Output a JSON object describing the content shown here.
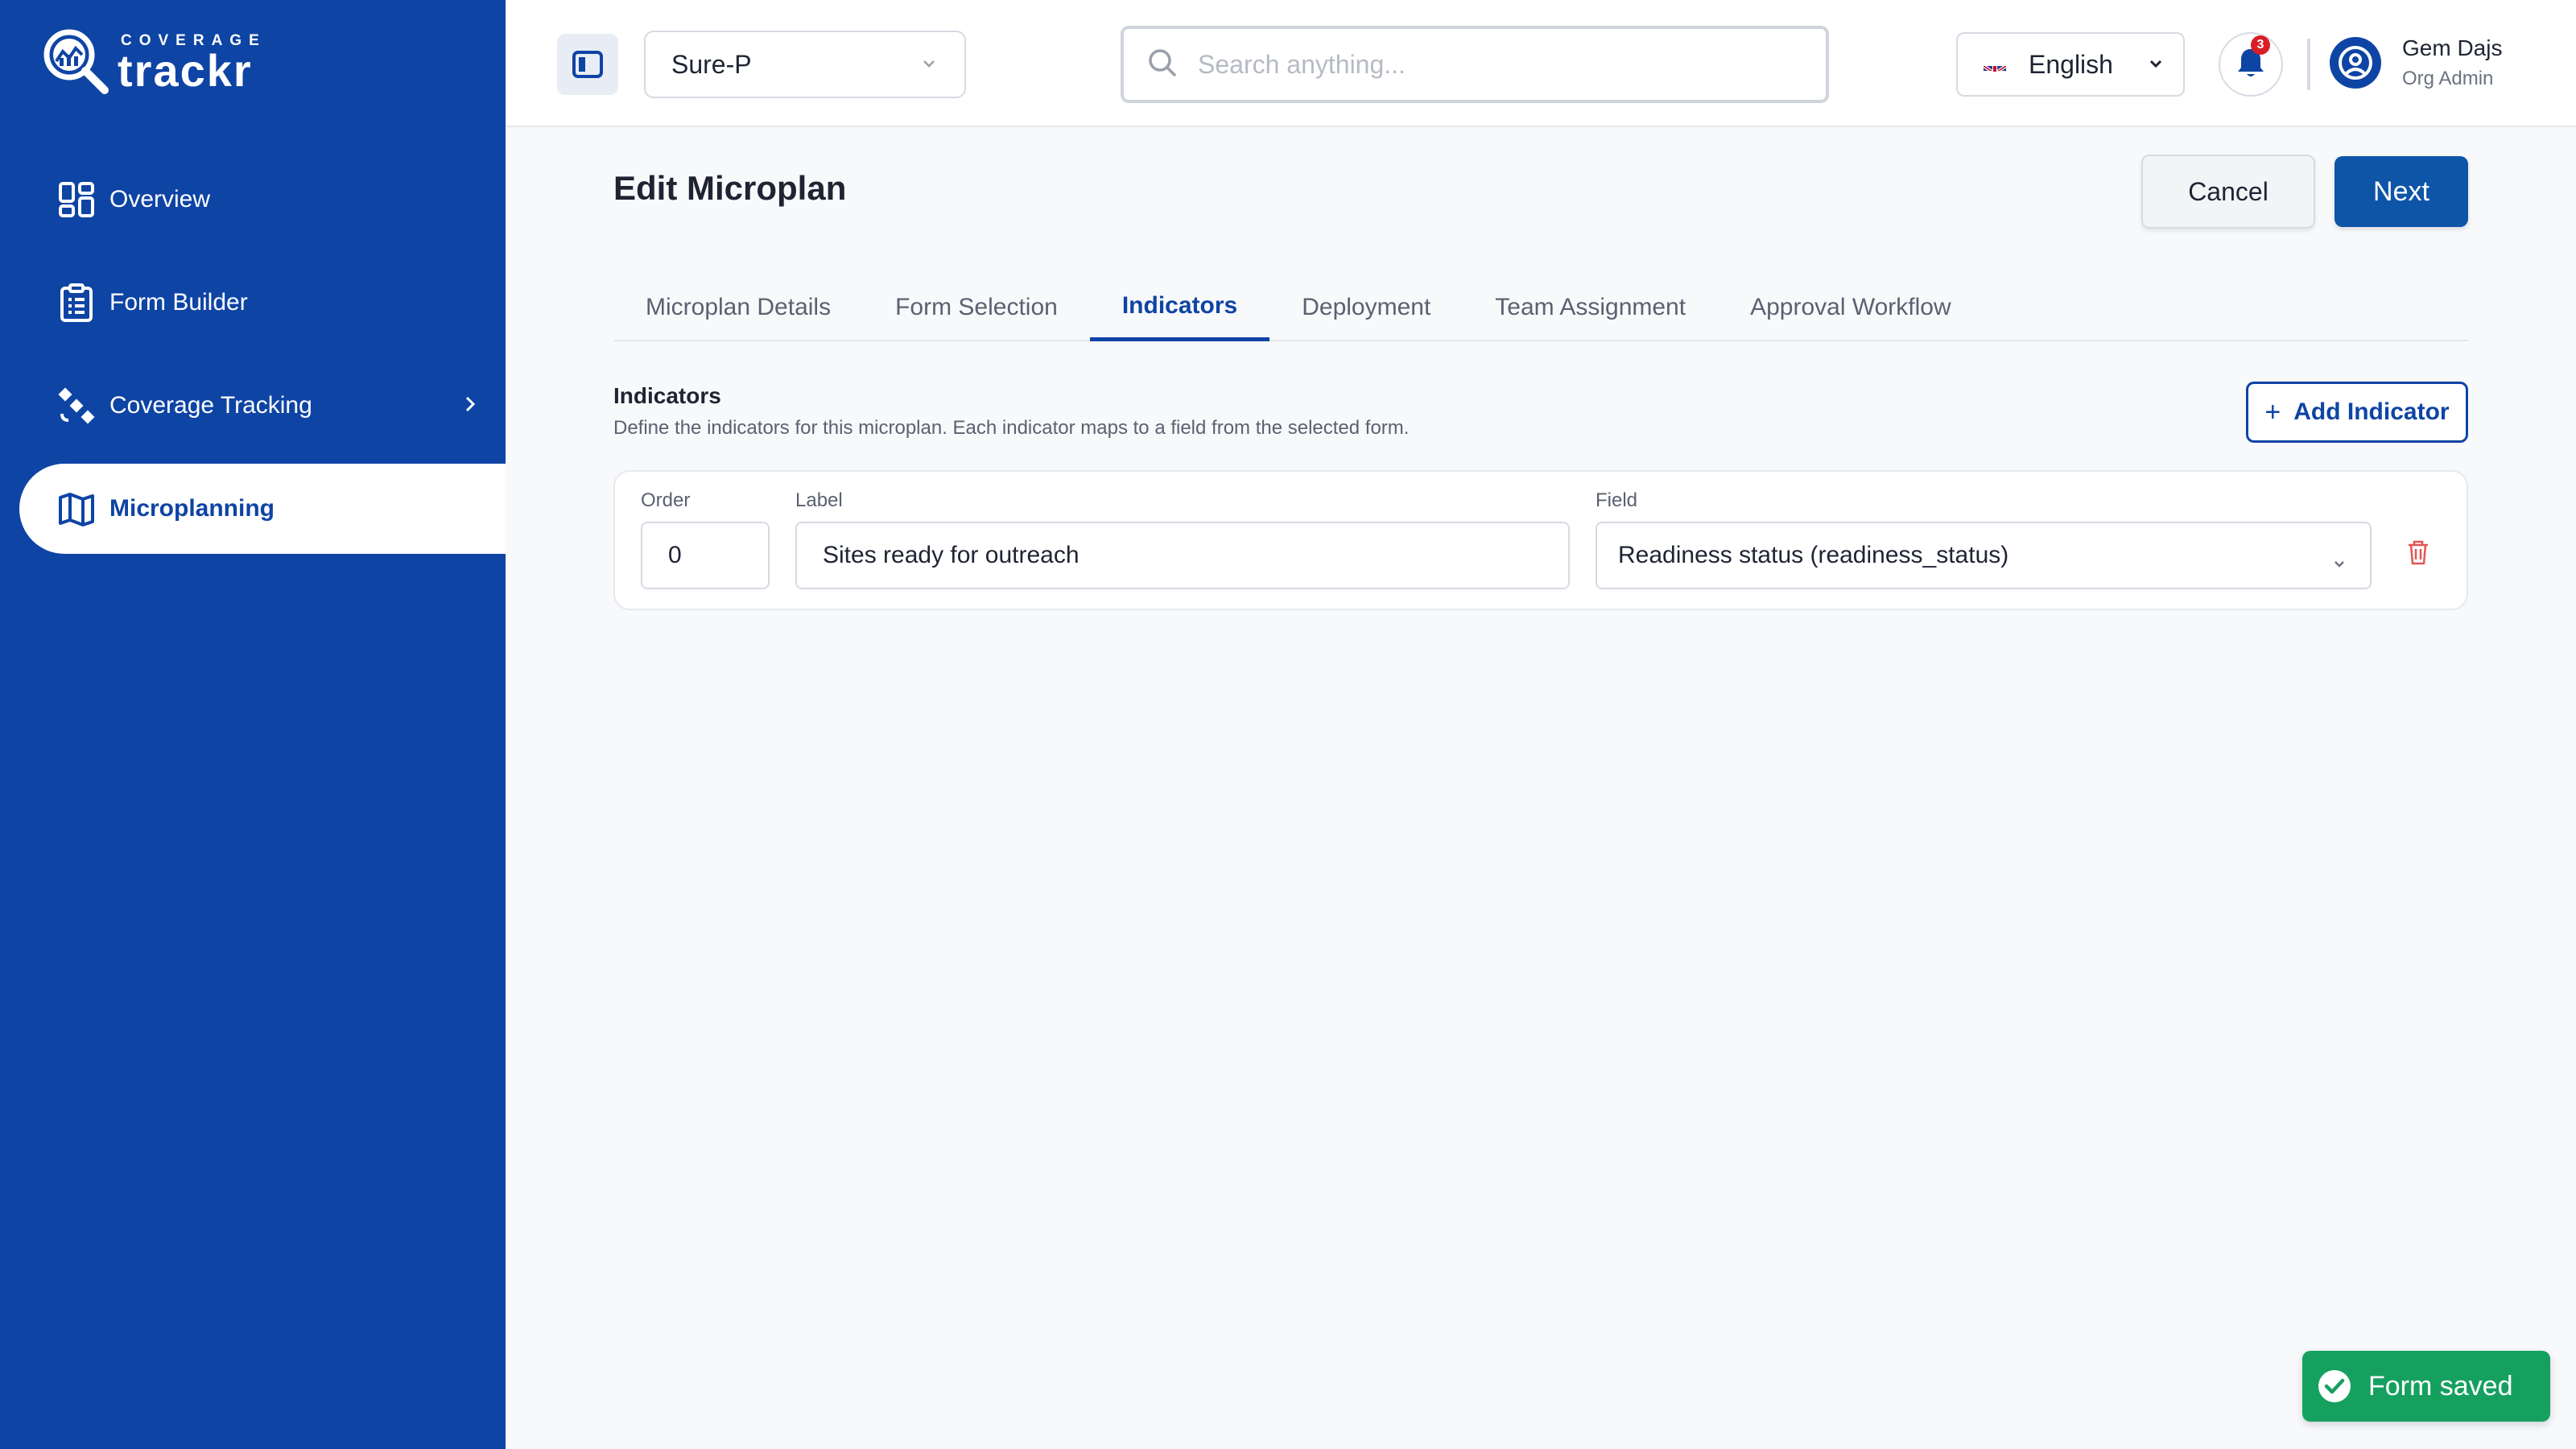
{
  "brand": {
    "small": "COVERAGE",
    "big": "trackr"
  },
  "sidebar": {
    "items": [
      {
        "label": "Overview",
        "icon": "dashboard-icon"
      },
      {
        "label": "Form Builder",
        "icon": "clipboard-icon"
      },
      {
        "label": "Coverage Tracking",
        "icon": "satellite-icon"
      },
      {
        "label": "Microplanning",
        "icon": "map-icon",
        "active": true
      }
    ]
  },
  "header": {
    "org_selected": "Sure-P",
    "search_placeholder": "Search anything...",
    "language": "English",
    "notification_count": "3",
    "user_name": "Gem Dajs",
    "user_role": "Org Admin"
  },
  "main": {
    "title": "Edit Microplan",
    "cancel_label": "Cancel",
    "next_label": "Next",
    "tabs": [
      {
        "label": "Microplan Details"
      },
      {
        "label": "Form Selection"
      },
      {
        "label": "Indicators",
        "active": true
      },
      {
        "label": "Deployment"
      },
      {
        "label": "Team Assignment"
      },
      {
        "label": "Approval Workflow"
      }
    ],
    "section_title": "Indicators",
    "section_desc": "Define the indicators for this microplan. Each indicator maps to a field from the selected form.",
    "add_label": "Add Indicator",
    "indicator": {
      "order_label": "Order",
      "order_value": "0",
      "label_label": "Label",
      "label_value": "Sites ready for outreach",
      "field_label": "Field",
      "field_value": "Readiness status (readiness_status)"
    }
  },
  "toast": {
    "text": "Form saved"
  },
  "colors": {
    "primary": "#0e44a4",
    "success": "#16a05f",
    "danger": "#d81f26"
  }
}
